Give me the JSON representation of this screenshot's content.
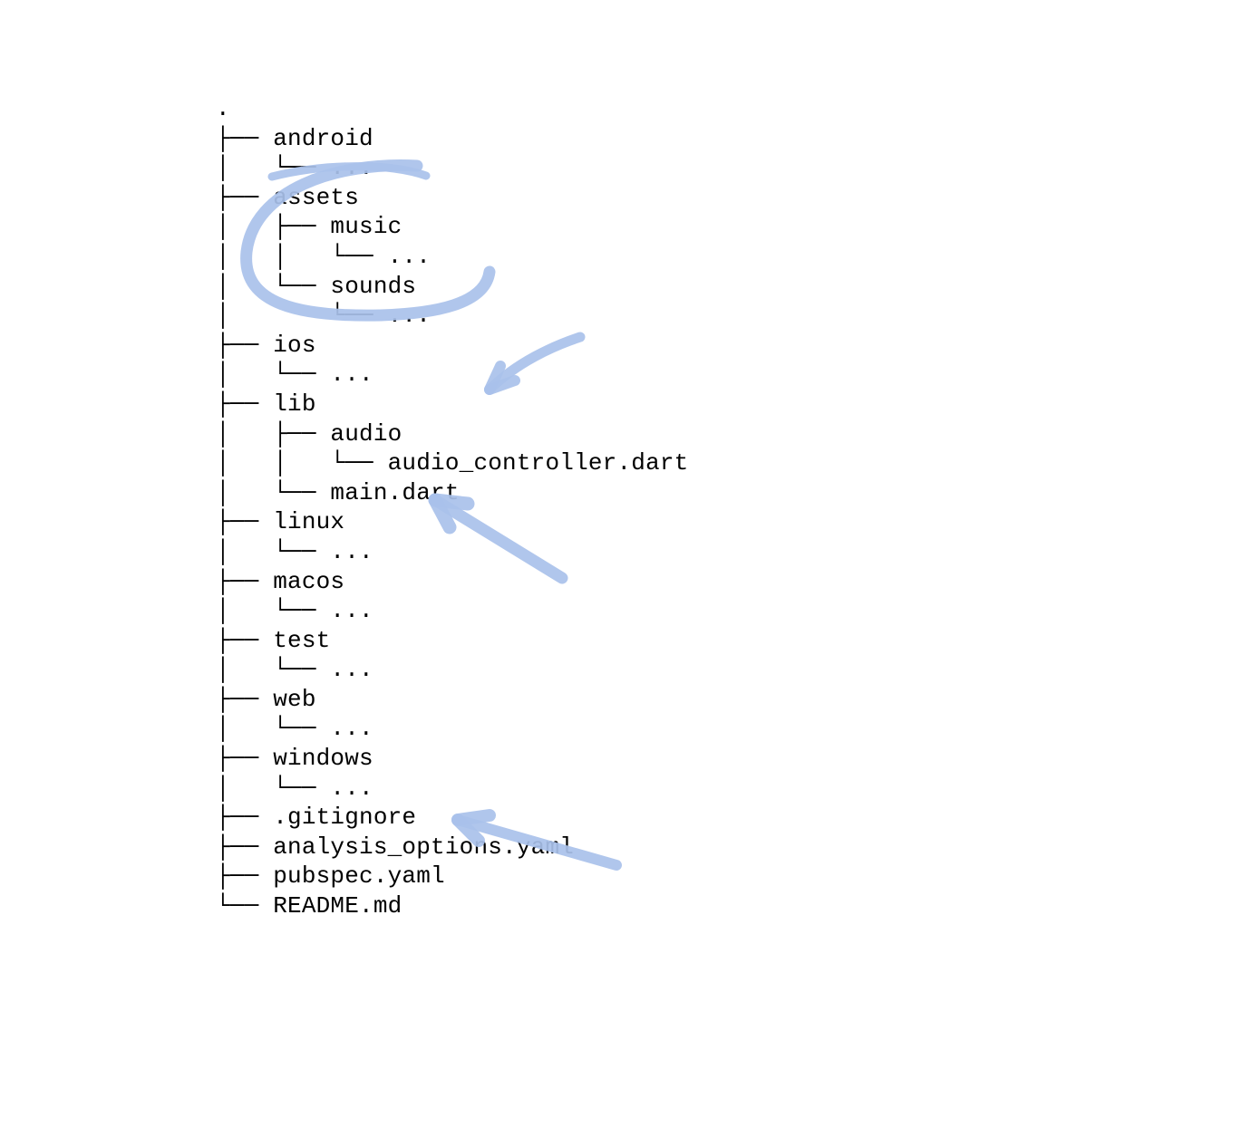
{
  "annotation_color": "#a9c1ea",
  "tree": {
    "lines": [
      ".",
      "├── android",
      "│   └── ...",
      "├── assets",
      "│   ├── music",
      "│   │   └── ...",
      "│   └── sounds",
      "│       └── ...",
      "├── ios",
      "│   └── ...",
      "├── lib",
      "│   ├── audio",
      "│   │   └── audio_controller.dart",
      "│   └── main.dart",
      "├── linux",
      "│   └── ...",
      "├── macos",
      "│   └── ...",
      "├── test",
      "│   └── ...",
      "├── web",
      "│   └── ...",
      "├── windows",
      "│   └── ...",
      "├── .gitignore",
      "├── analysis_options.yaml",
      "├── pubspec.yaml",
      "└── README.md"
    ]
  },
  "annotations": [
    {
      "shape": "circle",
      "target": "assets block",
      "note": "rough oval around assets/music/sounds"
    },
    {
      "shape": "arrow",
      "target": "lib/audio",
      "note": "curved arrow from upper-right toward lib"
    },
    {
      "shape": "arrow",
      "target": "main.dart",
      "note": "straight arrow from lower-right toward linux label (approx main.dart)"
    },
    {
      "shape": "arrow",
      "target": "pubspec.yaml",
      "note": "straight arrow from lower-right toward pubspec.yaml"
    }
  ]
}
